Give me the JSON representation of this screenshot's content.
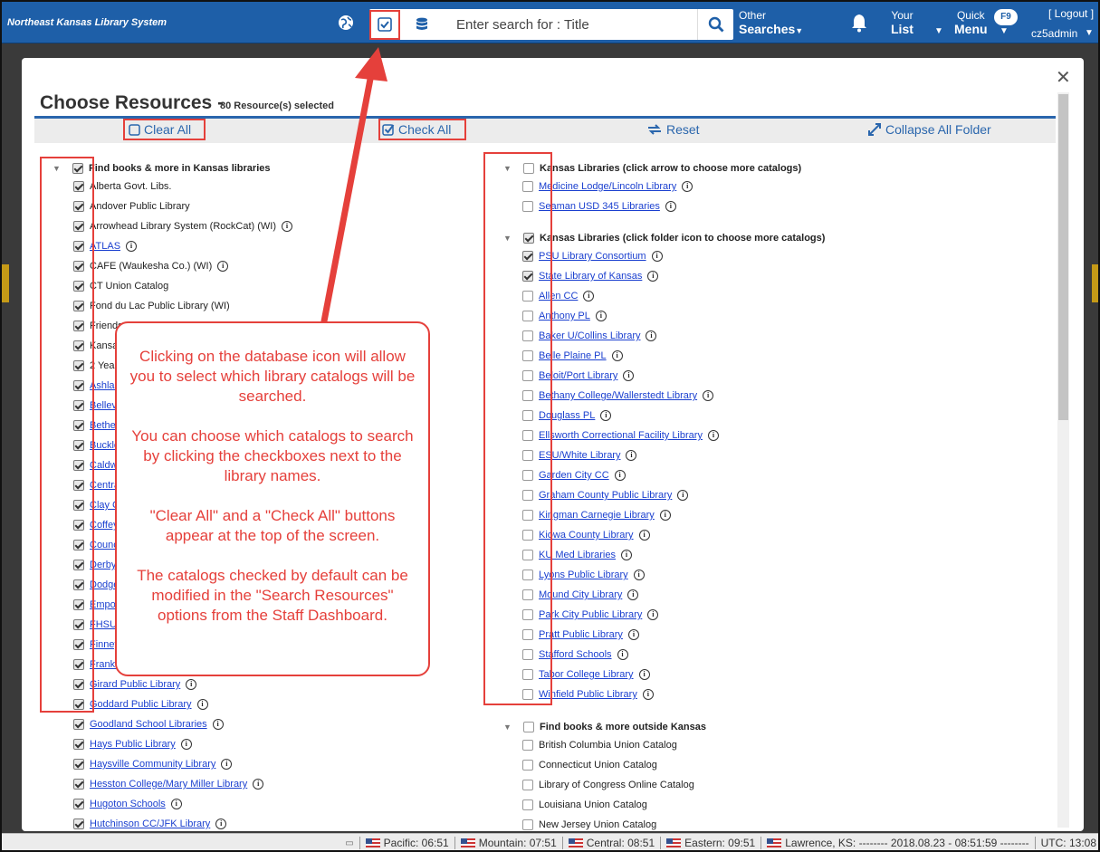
{
  "app": {
    "title": "Northeast Kansas Library System"
  },
  "search": {
    "placeholder": "Enter search for : Title"
  },
  "nav": {
    "other_l1": "Other",
    "other_l2": "Searches",
    "your_l1": "Your",
    "your_l2": "List",
    "quick_l1": "Quick",
    "quick_l2": "Menu",
    "f9": "F9",
    "logout": "[ Logout ]",
    "username": "cz5admin"
  },
  "modal": {
    "title": "Choose Resources -",
    "count": "80 Resource(s) selected",
    "clear_all": "Clear All",
    "check_all": "Check All",
    "reset": "Reset",
    "collapse": "Collapse All Folder"
  },
  "left_column": {
    "group": {
      "label": "Find books & more in Kansas libraries",
      "checked": true
    },
    "items": [
      {
        "label": "Alberta Govt. Libs.",
        "link": false,
        "info": false,
        "checked": true
      },
      {
        "label": "Andover Public Library",
        "link": false,
        "info": false,
        "checked": true
      },
      {
        "label": "Arrowhead Library System (RockCat) (WI)",
        "link": false,
        "info": true,
        "checked": true
      },
      {
        "label": "ATLAS",
        "link": true,
        "info": true,
        "checked": true
      },
      {
        "label": "CAFE (Waukesha Co.) (WI)",
        "link": false,
        "info": true,
        "checked": true
      },
      {
        "label": "CT Union Catalog",
        "link": false,
        "info": false,
        "checked": true
      },
      {
        "label": "Fond du Lac Public Library (WI)",
        "link": false,
        "info": false,
        "checked": true
      },
      {
        "label": "Friends",
        "link": false,
        "info": false,
        "checked": true
      },
      {
        "label": "Kansas",
        "link": false,
        "info": false,
        "checked": true
      },
      {
        "label": "2 Year",
        "link": false,
        "info": false,
        "checked": true
      },
      {
        "label": "Ashland",
        "link": true,
        "info": false,
        "checked": true
      },
      {
        "label": "Belleville",
        "link": true,
        "info": false,
        "checked": true
      },
      {
        "label": "Bethel",
        "link": true,
        "info": false,
        "checked": true
      },
      {
        "label": "Buckley",
        "link": true,
        "info": false,
        "checked": true
      },
      {
        "label": "Caldwell",
        "link": true,
        "info": false,
        "checked": true
      },
      {
        "label": "Central",
        "link": true,
        "info": false,
        "checked": true
      },
      {
        "label": "Clay Center",
        "link": true,
        "info": false,
        "checked": true
      },
      {
        "label": "Coffeyville",
        "link": true,
        "info": false,
        "checked": true
      },
      {
        "label": "Council Grove",
        "link": true,
        "info": false,
        "checked": true
      },
      {
        "label": "Derby",
        "link": true,
        "info": false,
        "checked": true
      },
      {
        "label": "Dodge City",
        "link": true,
        "info": false,
        "checked": true
      },
      {
        "label": "Emporia",
        "link": true,
        "info": false,
        "checked": true
      },
      {
        "label": "FHSU",
        "link": true,
        "info": false,
        "checked": true
      },
      {
        "label": "Finney",
        "link": true,
        "info": false,
        "checked": true
      },
      {
        "label": "Frankfort",
        "link": true,
        "info": false,
        "checked": true
      },
      {
        "label": "Girard Public Library",
        "link": true,
        "info": true,
        "checked": true
      },
      {
        "label": "Goddard Public Library",
        "link": true,
        "info": true,
        "checked": true
      },
      {
        "label": "Goodland School Libraries",
        "link": true,
        "info": true,
        "checked": true
      },
      {
        "label": "Hays Public Library",
        "link": true,
        "info": true,
        "checked": true
      },
      {
        "label": "Haysville Community Library",
        "link": true,
        "info": true,
        "checked": true
      },
      {
        "label": "Hesston College/Mary Miller Library",
        "link": true,
        "info": true,
        "checked": true
      },
      {
        "label": "Hugoton Schools",
        "link": true,
        "info": true,
        "checked": true
      },
      {
        "label": "Hutchinson CC/JFK Library",
        "link": true,
        "info": true,
        "checked": true
      }
    ]
  },
  "right_column": {
    "groups": [
      {
        "label": "Kansas Libraries (click arrow to choose more catalogs)",
        "checked": false,
        "items": [
          {
            "label": "Medicine Lodge/Lincoln Library",
            "link": true,
            "info": true,
            "checked": false
          },
          {
            "label": "Seaman USD 345 Libraries",
            "link": true,
            "info": true,
            "checked": false
          }
        ]
      },
      {
        "label": "Kansas Libraries (click folder icon to choose more catalogs)",
        "checked": true,
        "items": [
          {
            "label": "PSU Library Consortium",
            "link": true,
            "info": true,
            "checked": true
          },
          {
            "label": "State Library of Kansas",
            "link": true,
            "info": true,
            "checked": true
          },
          {
            "label": "Allen CC",
            "link": true,
            "info": true,
            "checked": false
          },
          {
            "label": "Anthony PL",
            "link": true,
            "info": true,
            "checked": false
          },
          {
            "label": "Baker U/Collins Library",
            "link": true,
            "info": true,
            "checked": false
          },
          {
            "label": "Belle Plaine PL",
            "link": true,
            "info": true,
            "checked": false
          },
          {
            "label": "Beloit/Port Library",
            "link": true,
            "info": true,
            "checked": false
          },
          {
            "label": "Bethany College/Wallerstedt Library",
            "link": true,
            "info": true,
            "checked": false
          },
          {
            "label": "Douglass PL",
            "link": true,
            "info": true,
            "checked": false
          },
          {
            "label": "Ellsworth Correctional Facility Library",
            "link": true,
            "info": true,
            "checked": false
          },
          {
            "label": "ESU/White Library",
            "link": true,
            "info": true,
            "checked": false
          },
          {
            "label": "Garden City CC",
            "link": true,
            "info": true,
            "checked": false
          },
          {
            "label": "Graham County Public Library",
            "link": true,
            "info": true,
            "checked": false
          },
          {
            "label": "Kingman Carnegie Library",
            "link": true,
            "info": true,
            "checked": false
          },
          {
            "label": "Kiowa County Library",
            "link": true,
            "info": true,
            "checked": false
          },
          {
            "label": "KU Med Libraries",
            "link": true,
            "info": true,
            "checked": false
          },
          {
            "label": "Lyons Public Library",
            "link": true,
            "info": true,
            "checked": false
          },
          {
            "label": "Mound City Library",
            "link": true,
            "info": true,
            "checked": false
          },
          {
            "label": "Park City Public Library",
            "link": true,
            "info": true,
            "checked": false
          },
          {
            "label": "Pratt Public Library",
            "link": true,
            "info": true,
            "checked": false
          },
          {
            "label": "Stafford Schools",
            "link": true,
            "info": true,
            "checked": false
          },
          {
            "label": "Tabor College Library",
            "link": true,
            "info": true,
            "checked": false
          },
          {
            "label": "Winfield Public Library",
            "link": true,
            "info": true,
            "checked": false
          }
        ]
      },
      {
        "label": "Find books & more outside Kansas",
        "checked": false,
        "items": [
          {
            "label": "British Columbia Union Catalog",
            "link": false,
            "info": false,
            "checked": false
          },
          {
            "label": "Connecticut Union Catalog",
            "link": false,
            "info": false,
            "checked": false
          },
          {
            "label": "Library of Congress Online Catalog",
            "link": false,
            "info": false,
            "checked": false
          },
          {
            "label": "Louisiana Union Catalog",
            "link": false,
            "info": false,
            "checked": false
          },
          {
            "label": "New Jersey Union Catalog",
            "link": false,
            "info": false,
            "checked": false
          }
        ]
      }
    ]
  },
  "callout": {
    "p1": "Clicking on the database icon will allow you to select which library catalogs will be searched.",
    "p2": "You can choose which catalogs to search by clicking the checkboxes next to the library names.",
    "p3": "\"Clear All\" and a \"Check All\" buttons appear at the top of the screen.",
    "p4": "The catalogs checked by default can be modified in the \"Search Resources\" options from the Staff Dashboard."
  },
  "status": {
    "zones": [
      "Pacific: 06:51",
      "Mountain: 07:51",
      "Central: 08:51",
      "Eastern: 09:51",
      "Lawrence, KS: -------- 2018.08.23 - 08:51:59 --------",
      "UTC: 13:08"
    ]
  },
  "colors": {
    "brand": "#1e5fa8",
    "accent": "#2a66ad",
    "annotation": "#e5403b",
    "link": "#1a3fcf"
  }
}
